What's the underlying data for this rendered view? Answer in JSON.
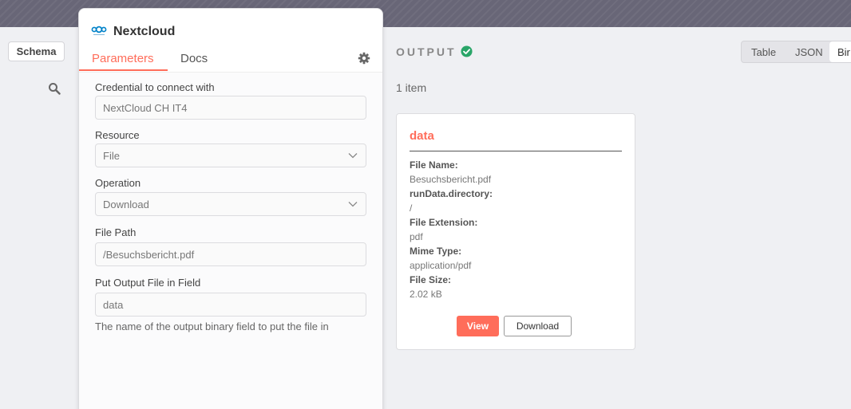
{
  "input_pane": {
    "schema_label": "Schema"
  },
  "node": {
    "title": "Nextcloud",
    "tabs": {
      "parameters": "Parameters",
      "docs": "Docs"
    },
    "fields": {
      "credential": {
        "label": "Credential to connect with",
        "value": "NextCloud CH IT4"
      },
      "resource": {
        "label": "Resource",
        "value": "File"
      },
      "operation": {
        "label": "Operation",
        "value": "Download"
      },
      "file_path": {
        "label": "File Path",
        "value": "/Besuchsbericht.pdf"
      },
      "output_field": {
        "label": "Put Output File in Field",
        "value": "data",
        "hint": "The name of the output binary field to put the file in"
      }
    }
  },
  "output": {
    "title": "OUTPUT",
    "status_color": "#29a568",
    "view_modes": {
      "table": "Table",
      "json": "JSON",
      "binary": "Bir"
    },
    "item_count": "1 item",
    "card": {
      "title": "data",
      "file_name_label": "File Name:",
      "file_name": "Besuchsbericht.pdf",
      "directory_label": "runData.directory:",
      "directory": "/",
      "extension_label": "File Extension:",
      "extension": "pdf",
      "mime_label": "Mime Type:",
      "mime": "application/pdf",
      "size_label": "File Size:",
      "size": "2.02 kB",
      "view_label": "View",
      "download_label": "Download"
    }
  },
  "colors": {
    "accent": "#ff6d5a",
    "topbar": "#686677",
    "success": "#29a568"
  }
}
